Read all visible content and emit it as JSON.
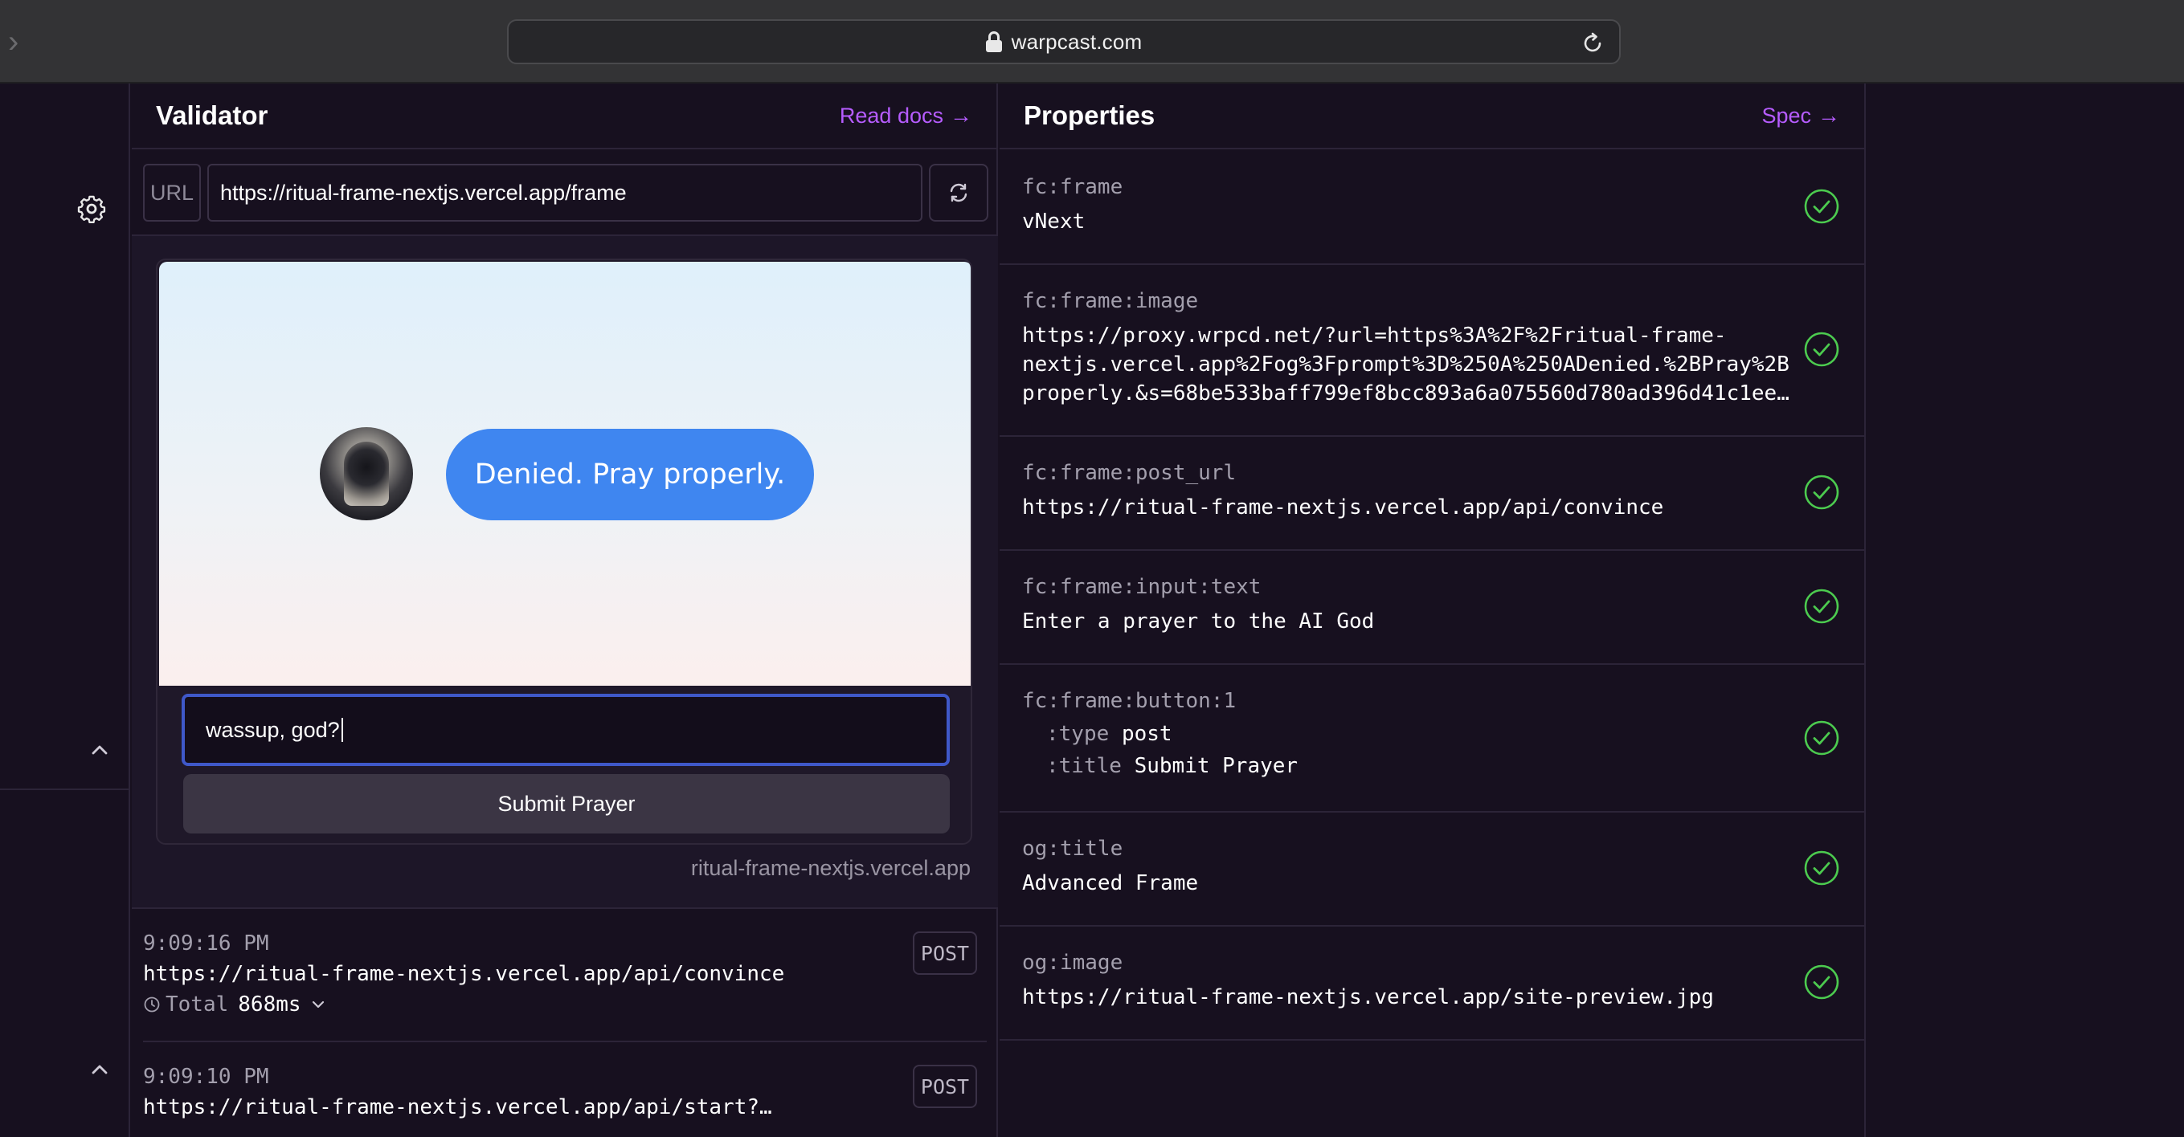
{
  "browser": {
    "address": "warpcast.com"
  },
  "validator": {
    "title": "Validator",
    "docs_link": "Read docs",
    "url_tag": "URL",
    "url_value": "https://ritual-frame-nextjs.vercel.app/frame",
    "frame": {
      "bubble_text": "Denied. Pray properly.",
      "input_value": "wassup, god?",
      "button_label": "Submit Prayer",
      "host": "ritual-frame-nextjs.vercel.app"
    },
    "logs": [
      {
        "time": "9:09:16 PM",
        "method": "POST",
        "url": "https://ritual-frame-nextjs.vercel.app/api/convince",
        "total_label": "Total",
        "total_value": "868ms"
      },
      {
        "time": "9:09:10 PM",
        "method": "POST",
        "url": "https://ritual-frame-nextjs.vercel.app/api/start?…"
      }
    ]
  },
  "properties": {
    "title": "Properties",
    "spec_link": "Spec",
    "items": [
      {
        "key": "fc:frame",
        "value": "vNext",
        "status": "valid"
      },
      {
        "key": "fc:frame:image",
        "value": "https://proxy.wrpcd.net/?url=https%3A%2F%2Fritual-frame-\nnextjs.vercel.app%2Fog%3Fprompt%3D%250A%250ADenied.%2BPray%2B\nproperly.&s=68be533baff799ef8bcc893a6a075560d780ad396d41c1ee…",
        "status": "valid"
      },
      {
        "key": "fc:frame:post_url",
        "value": "https://ritual-frame-nextjs.vercel.app/api/convince",
        "status": "valid"
      },
      {
        "key": "fc:frame:input:text",
        "value": "Enter a prayer to the AI God",
        "status": "valid"
      },
      {
        "key": "fc:frame:button:1",
        "type_key": ":type",
        "type_value": "post",
        "title_key": ":title",
        "title_value": "Submit Prayer",
        "status": "valid"
      },
      {
        "key": "og:title",
        "value": "Advanced Frame",
        "status": "valid"
      },
      {
        "key": "og:image",
        "value": "https://ritual-frame-nextjs.vercel.app/site-preview.jpg",
        "status": "valid"
      }
    ]
  },
  "colors": {
    "accent": "#b65cff",
    "check": "#4ccb4f",
    "bubble": "#3f86f0",
    "background": "#17101f"
  }
}
